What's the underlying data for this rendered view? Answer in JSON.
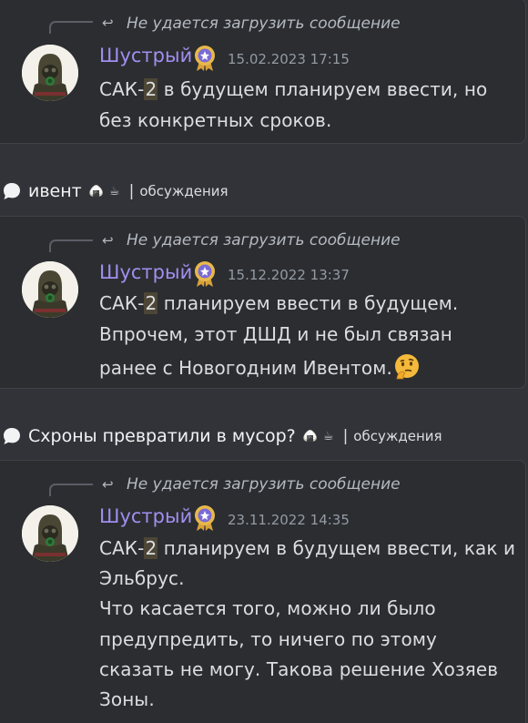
{
  "colors": {
    "background": "#313338",
    "card": "#2b2d31",
    "username": "#a28eef",
    "timestamp": "#949ba4",
    "mention_highlight": "#4d4636"
  },
  "reply_preview_text": "Не удается загрузить сообщение",
  "messages": [
    {
      "username": "Шустрый",
      "timestamp": "15.02.2023 17:15",
      "lines": [
        {
          "pre": "САК-",
          "hl": "2",
          "post": " в будущем планируем ввести, но"
        },
        {
          "text": "без конкретных сроков."
        }
      ]
    },
    {
      "username": "Шустрый",
      "timestamp": "15.12.2022 13:37",
      "lines": [
        {
          "pre": "САК-",
          "hl": "2",
          "post": " планируем ввести в будущем."
        },
        {
          "text": "Впрочем, этот ДШД и не был связан"
        },
        {
          "text": "ранее с Новогодним Ивентом.",
          "emoji": "thinking-face-icon"
        }
      ]
    },
    {
      "username": "Шустрый",
      "timestamp": "23.11.2022 14:35",
      "lines": [
        {
          "pre": "САК-",
          "hl": "2",
          "post": " планируем в будущем ввести, как и"
        },
        {
          "text": "Эльбрус."
        },
        {
          "text": "Что касается того, можно ли было"
        },
        {
          "text": "предупредить, то ничего по этому"
        },
        {
          "text": "сказать не могу. Такова решение Хозяев"
        },
        {
          "text": "Зоны."
        }
      ]
    }
  ],
  "threads": [
    {
      "title": "ивент",
      "emojis": [
        "🍙",
        "☕"
      ],
      "separator": "|",
      "tag": "обсуждения"
    },
    {
      "title": "Схроны превратили в мусор?",
      "emojis": [
        "🍙",
        "☕"
      ],
      "separator": "|",
      "tag": "обсуждения"
    }
  ],
  "icons": {
    "reply": "reply-arrow-icon",
    "badge": "rosette-badge-icon",
    "thread": "speech-bubble-icon"
  }
}
